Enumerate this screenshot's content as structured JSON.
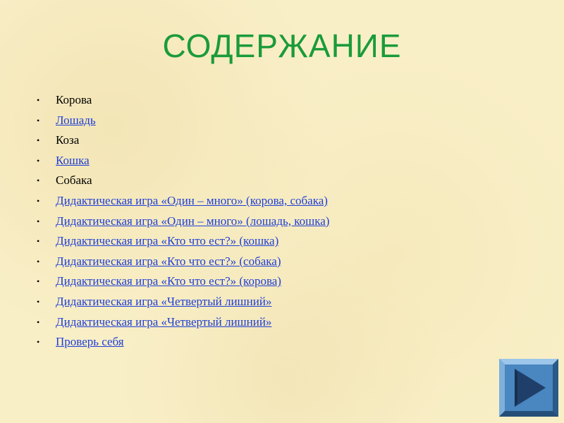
{
  "slide": {
    "title": "СОДЕРЖАНИЕ",
    "items": [
      {
        "label": "Корова",
        "link": false
      },
      {
        "label": "Лошадь",
        "link": true
      },
      {
        "label": "Коза",
        "link": false
      },
      {
        "label": "Кошка",
        "link": true
      },
      {
        "label": "Собака",
        "link": false
      },
      {
        "label": "Дидактическая игра «Один – много» (корова, собака)",
        "link": true
      },
      {
        "label": "Дидактическая игра «Один – много» (лошадь, кошка)",
        "link": true
      },
      {
        "label": "Дидактическая игра «Кто что ест?» (кошка)",
        "link": true
      },
      {
        "label": "Дидактическая игра «Кто что ест?» (собака)",
        "link": true
      },
      {
        "label": "Дидактическая игра «Кто что ест?» (корова)",
        "link": true
      },
      {
        "label": "Дидактическая игра «Четвертый лишний»",
        "link": true
      },
      {
        "label": "Дидактическая игра «Четвертый лишний»",
        "link": true
      },
      {
        "label": "Проверь себя",
        "link": true
      }
    ],
    "bullet_glyph": "•",
    "next_button_icon": "play-arrow-icon"
  },
  "colors": {
    "title": "#1a9b3a",
    "link": "#1f3fd6",
    "background": "#f9efc7",
    "button_fill": "#4a86c0",
    "button_arrow": "#1f3f6a"
  }
}
